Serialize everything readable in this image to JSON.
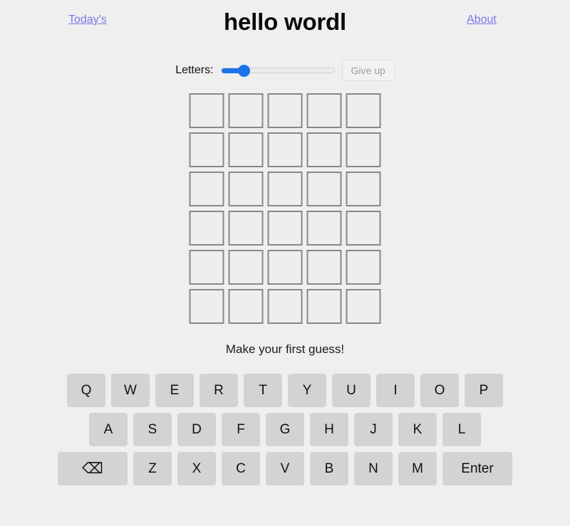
{
  "header": {
    "title": "hello wordl",
    "left_link": "Today's",
    "right_link": "About"
  },
  "controls": {
    "letters_label": "Letters:",
    "give_up_label": "Give up",
    "slider": {
      "value": 5,
      "min": 4,
      "max": 11
    }
  },
  "board": {
    "rows": 6,
    "columns": 5,
    "tiles": [
      [
        "",
        "",
        "",
        "",
        ""
      ],
      [
        "",
        "",
        "",
        "",
        ""
      ],
      [
        "",
        "",
        "",
        "",
        ""
      ],
      [
        "",
        "",
        "",
        "",
        ""
      ],
      [
        "",
        "",
        "",
        "",
        ""
      ],
      [
        "",
        "",
        "",
        "",
        ""
      ]
    ]
  },
  "message": "Make your first guess!",
  "keyboard": {
    "rows": [
      [
        {
          "label": "Q",
          "name": "key-q",
          "wide": false
        },
        {
          "label": "W",
          "name": "key-w",
          "wide": false
        },
        {
          "label": "E",
          "name": "key-e",
          "wide": false
        },
        {
          "label": "R",
          "name": "key-r",
          "wide": false
        },
        {
          "label": "T",
          "name": "key-t",
          "wide": false
        },
        {
          "label": "Y",
          "name": "key-y",
          "wide": false
        },
        {
          "label": "U",
          "name": "key-u",
          "wide": false
        },
        {
          "label": "I",
          "name": "key-i",
          "wide": false
        },
        {
          "label": "O",
          "name": "key-o",
          "wide": false
        },
        {
          "label": "P",
          "name": "key-p",
          "wide": false
        }
      ],
      [
        {
          "label": "A",
          "name": "key-a",
          "wide": false
        },
        {
          "label": "S",
          "name": "key-s",
          "wide": false
        },
        {
          "label": "D",
          "name": "key-d",
          "wide": false
        },
        {
          "label": "F",
          "name": "key-f",
          "wide": false
        },
        {
          "label": "G",
          "name": "key-g",
          "wide": false
        },
        {
          "label": "H",
          "name": "key-h",
          "wide": false
        },
        {
          "label": "J",
          "name": "key-j",
          "wide": false
        },
        {
          "label": "K",
          "name": "key-k",
          "wide": false
        },
        {
          "label": "L",
          "name": "key-l",
          "wide": false
        }
      ],
      [
        {
          "label": "⌫",
          "name": "key-backspace-icon",
          "wide": true
        },
        {
          "label": "Z",
          "name": "key-z",
          "wide": false
        },
        {
          "label": "X",
          "name": "key-x",
          "wide": false
        },
        {
          "label": "C",
          "name": "key-c",
          "wide": false
        },
        {
          "label": "V",
          "name": "key-v",
          "wide": false
        },
        {
          "label": "B",
          "name": "key-b",
          "wide": false
        },
        {
          "label": "N",
          "name": "key-n",
          "wide": false
        },
        {
          "label": "M",
          "name": "key-m",
          "wide": false
        },
        {
          "label": "Enter",
          "name": "key-enter",
          "wide": true
        }
      ]
    ]
  },
  "colors": {
    "page_background": "#efefef",
    "link": "#7b78e5",
    "slider_accent": "#1a73e8",
    "key_background": "#d3d3d3",
    "tile_border": "#888888",
    "tile_background": "#eeeeee"
  }
}
